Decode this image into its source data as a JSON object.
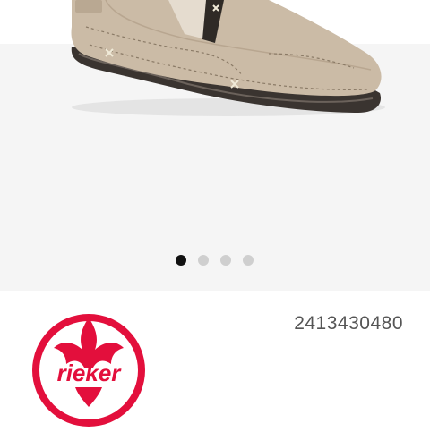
{
  "product": {
    "image_alt": "Taupe leather slip-on shoe",
    "article_number": "2413430480"
  },
  "carousel": {
    "page_count": 4,
    "active_index": 0
  },
  "brand": {
    "name": "rieker",
    "logo_color": "#e30f3c"
  },
  "colors": {
    "gallery_background": "#f5f5f5",
    "shoe_upper": "#cbbba6",
    "sole": "#3a3430",
    "active_dot": "#111111",
    "inactive_dot": "#cfcfcf"
  }
}
